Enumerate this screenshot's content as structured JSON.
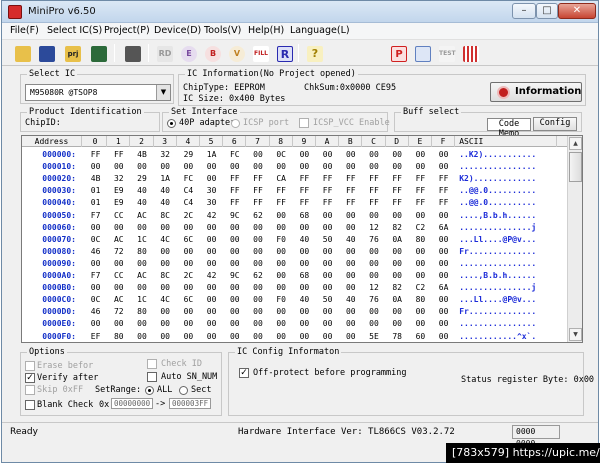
{
  "window": {
    "title": "MiniPro v6.50",
    "min_glyph": "–",
    "max_glyph": "□",
    "close_glyph": "✕"
  },
  "menu": [
    "File(F)",
    "Select IC(S)",
    "Project(P)",
    "Device(D)",
    "Tools(V)",
    "Help(H)",
    "Language(L)"
  ],
  "toolbar": {
    "buttons": [
      {
        "name": "open-icon",
        "glyph": "",
        "color": "#e8c04a"
      },
      {
        "name": "save-icon",
        "glyph": "",
        "color": "#2c4a9a"
      },
      {
        "name": "open-project-icon",
        "glyph": "prj",
        "color": "#e8c04a"
      },
      {
        "name": "save-project-icon",
        "glyph": "",
        "color": "#2c6a3a"
      },
      {
        "name": "select-ic-icon",
        "glyph": "",
        "color": "#555555"
      },
      {
        "name": "read-icon",
        "glyph": "RD",
        "color": "#aaaaaa"
      },
      {
        "name": "erase-icon",
        "glyph": "E",
        "color": "#7a4aa0"
      },
      {
        "name": "blank-check-icon",
        "glyph": "B",
        "color": "#c02020"
      },
      {
        "name": "verify-icon",
        "glyph": "V",
        "color": "#c08020"
      },
      {
        "name": "fill-icon",
        "glyph": "FILL",
        "color": "#c02020"
      },
      {
        "name": "program-icon",
        "glyph": "R",
        "color": "#2a2ab0"
      },
      {
        "name": "help-icon",
        "glyph": "?",
        "color": "#e0c020"
      },
      {
        "name": "production-icon",
        "glyph": "P",
        "color": "#d02020"
      },
      {
        "name": "config-icon",
        "glyph": "",
        "color": "#6080c0"
      },
      {
        "name": "test-icon",
        "glyph": "TEST",
        "color": "#bbbbbb"
      },
      {
        "name": "logic-icon",
        "glyph": "",
        "color": "#d03030"
      }
    ]
  },
  "select_ic": {
    "label": "Select IC",
    "value": "M95080R @TSOP8",
    "arrow": "▼"
  },
  "ic_info": {
    "label": "IC Information(No Project opened)",
    "chip_type": "ChipType:  EEPROM",
    "checksum": "ChkSum:0x0000 CE95",
    "ic_size": "IC Size:   0x400 Bytes",
    "button": "Information"
  },
  "product": {
    "label": "Product Identification",
    "chip_id": "ChipID:"
  },
  "interface": {
    "label": "Set Interface",
    "opt1": "40P adapter",
    "opt2": "ICSP port",
    "opt3": "ICSP_VCC Enable"
  },
  "buff": {
    "label": "Buff select",
    "code_memo": "Code Memo",
    "config": "Config"
  },
  "grid": {
    "headers": [
      "Address",
      "0",
      "1",
      "2",
      "3",
      "4",
      "5",
      "6",
      "7",
      "8",
      "9",
      "A",
      "B",
      "C",
      "D",
      "E",
      "F",
      "ASCII"
    ],
    "rows": [
      {
        "addr": "000000:",
        "b": [
          "FF",
          "FF",
          "4B",
          "32",
          "29",
          "1A",
          "FC",
          "00",
          "0C",
          "00",
          "00",
          "00",
          "00",
          "00",
          "00",
          "00"
        ],
        "ascii": "..K2)..........."
      },
      {
        "addr": "000010:",
        "b": [
          "00",
          "00",
          "00",
          "00",
          "00",
          "00",
          "00",
          "00",
          "00",
          "00",
          "00",
          "00",
          "00",
          "00",
          "00",
          "00"
        ],
        "ascii": "................"
      },
      {
        "addr": "000020:",
        "b": [
          "4B",
          "32",
          "29",
          "1A",
          "FC",
          "00",
          "FF",
          "FF",
          "CA",
          "FF",
          "FF",
          "FF",
          "FF",
          "FF",
          "FF",
          "FF"
        ],
        "ascii": "K2)............."
      },
      {
        "addr": "000030:",
        "b": [
          "01",
          "E9",
          "40",
          "40",
          "C4",
          "30",
          "FF",
          "FF",
          "FF",
          "FF",
          "FF",
          "FF",
          "FF",
          "FF",
          "FF",
          "FF"
        ],
        "ascii": "..@@.0.........."
      },
      {
        "addr": "000040:",
        "b": [
          "01",
          "E9",
          "40",
          "40",
          "C4",
          "30",
          "FF",
          "FF",
          "FF",
          "FF",
          "FF",
          "FF",
          "FF",
          "FF",
          "FF",
          "FF"
        ],
        "ascii": "..@@.0.........."
      },
      {
        "addr": "000050:",
        "b": [
          "F7",
          "CC",
          "AC",
          "8C",
          "2C",
          "42",
          "9C",
          "62",
          "00",
          "68",
          "00",
          "00",
          "00",
          "00",
          "00",
          "00"
        ],
        "ascii": "....,B.b.h......"
      },
      {
        "addr": "000060:",
        "b": [
          "00",
          "00",
          "00",
          "00",
          "00",
          "00",
          "00",
          "00",
          "00",
          "00",
          "00",
          "00",
          "12",
          "82",
          "C2",
          "6A"
        ],
        "ascii": "...............j"
      },
      {
        "addr": "000070:",
        "b": [
          "0C",
          "AC",
          "1C",
          "4C",
          "6C",
          "00",
          "00",
          "00",
          "F0",
          "40",
          "50",
          "40",
          "76",
          "0A",
          "80",
          "00"
        ],
        "ascii": "...Ll....@P@v..."
      },
      {
        "addr": "000080:",
        "b": [
          "46",
          "72",
          "80",
          "00",
          "00",
          "00",
          "00",
          "00",
          "00",
          "00",
          "00",
          "00",
          "00",
          "00",
          "00",
          "00"
        ],
        "ascii": "Fr.............."
      },
      {
        "addr": "000090:",
        "b": [
          "00",
          "00",
          "00",
          "00",
          "00",
          "00",
          "00",
          "00",
          "00",
          "00",
          "00",
          "00",
          "00",
          "00",
          "00",
          "00"
        ],
        "ascii": "................"
      },
      {
        "addr": "0000A0:",
        "b": [
          "F7",
          "CC",
          "AC",
          "8C",
          "2C",
          "42",
          "9C",
          "62",
          "00",
          "68",
          "00",
          "00",
          "00",
          "00",
          "00",
          "00"
        ],
        "ascii": "....,B.b.h......"
      },
      {
        "addr": "0000B0:",
        "b": [
          "00",
          "00",
          "00",
          "00",
          "00",
          "00",
          "00",
          "00",
          "00",
          "00",
          "00",
          "00",
          "12",
          "82",
          "C2",
          "6A"
        ],
        "ascii": "...............j"
      },
      {
        "addr": "0000C0:",
        "b": [
          "0C",
          "AC",
          "1C",
          "4C",
          "6C",
          "00",
          "00",
          "00",
          "F0",
          "40",
          "50",
          "40",
          "76",
          "0A",
          "80",
          "00"
        ],
        "ascii": "...Ll....@P@v..."
      },
      {
        "addr": "0000D0:",
        "b": [
          "46",
          "72",
          "80",
          "00",
          "00",
          "00",
          "00",
          "00",
          "00",
          "00",
          "00",
          "00",
          "00",
          "00",
          "00",
          "00"
        ],
        "ascii": "Fr.............."
      },
      {
        "addr": "0000E0:",
        "b": [
          "00",
          "00",
          "00",
          "00",
          "00",
          "00",
          "00",
          "00",
          "00",
          "00",
          "00",
          "00",
          "00",
          "00",
          "00",
          "00"
        ],
        "ascii": "................"
      },
      {
        "addr": "0000F0:",
        "b": [
          "EF",
          "80",
          "00",
          "00",
          "00",
          "00",
          "00",
          "00",
          "00",
          "00",
          "00",
          "00",
          "5E",
          "78",
          "60",
          "00"
        ],
        "ascii": "............^x`."
      }
    ],
    "scroll_up": "▲",
    "scroll_down": "▼"
  },
  "options": {
    "label": "Options",
    "erase_before": "Erase befor",
    "verify_after": "Verify after",
    "skip_0xff": "Skip 0xFF",
    "blank_check": "Blank Check",
    "check_id": "Check ID",
    "auto_sn": "Auto SN_NUM",
    "set_range": "SetRange:",
    "all": "ALL",
    "sect": "Sect",
    "ox": "0x",
    "range_from": "00000000",
    "range_arrow": "->",
    "range_to": "000003FF",
    "check_mark": "✓"
  },
  "ic_config": {
    "label": "IC Config Informaton",
    "off_protect": "Off-protect before programming",
    "status_byte": "Status register Byte: 0x00"
  },
  "status": {
    "ready": "Ready",
    "hardware": "Hardware Interface Ver: TL866CS V03.2.72",
    "box": "0000 0000"
  },
  "watermark": "[783x579] https://upic.me/"
}
